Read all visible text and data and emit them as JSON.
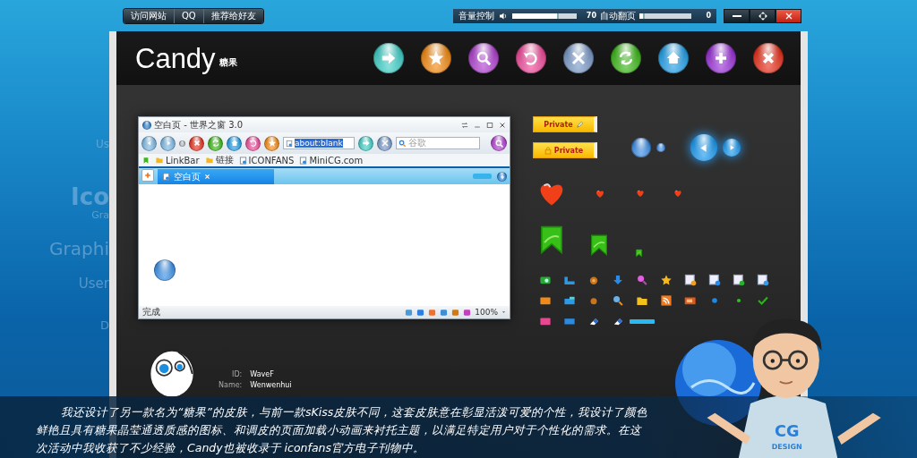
{
  "top_bar": {
    "links": [
      "访问网站",
      "QQ",
      "推荐给好友"
    ],
    "volume": {
      "label": "音量控制",
      "level": 0.7,
      "reading": "70"
    },
    "auto_page": {
      "label": "自动翻页",
      "level": 0,
      "reading": "0"
    }
  },
  "background_words": [
    "Us",
    "Ico",
    "Gra",
    "Graphi",
    "User",
    "D"
  ],
  "header": {
    "title": "Candy",
    "subtitle": "糖果"
  },
  "browser": {
    "title": "空白页 - 世界之窗 3.0",
    "address": "about:blank",
    "search_placeholder": "谷歌",
    "links": [
      {
        "label": "LinkBar",
        "kind": "folder"
      },
      {
        "label": "链接",
        "kind": "folder"
      },
      {
        "label": "ICONFANS",
        "kind": "page"
      },
      {
        "label": "MiniCG.com",
        "kind": "page"
      }
    ],
    "tabs": [
      {
        "label": "空白页",
        "selected": true
      }
    ],
    "status": "完成",
    "zoom": "100%"
  },
  "samples": {
    "buttons": [
      {
        "label": "Private",
        "kind": "edit"
      },
      {
        "label": "Private",
        "kind": "locked"
      }
    ]
  },
  "author": {
    "id_label": "ID:",
    "id": "WaveF",
    "name_label": "Name:",
    "name": "Wenwenhui"
  },
  "caption": "我还设计了另一款名为“糖果”的皮肤，与前一款sKiss皮肤不同，这套皮肤意在彰显活泼可爱的个性，我设计了颜色鲜艳且具有糖果晶莹通透质感的图标、和调皮的页面加载小动画来衬托主题，以满足特定用户对于个性化的需求。在这次活动中我收获了不少经验，Candy也被收录于 iconfans官方电子刊物中。",
  "shirt": {
    "logo": "CG",
    "text": "DESIGN"
  }
}
